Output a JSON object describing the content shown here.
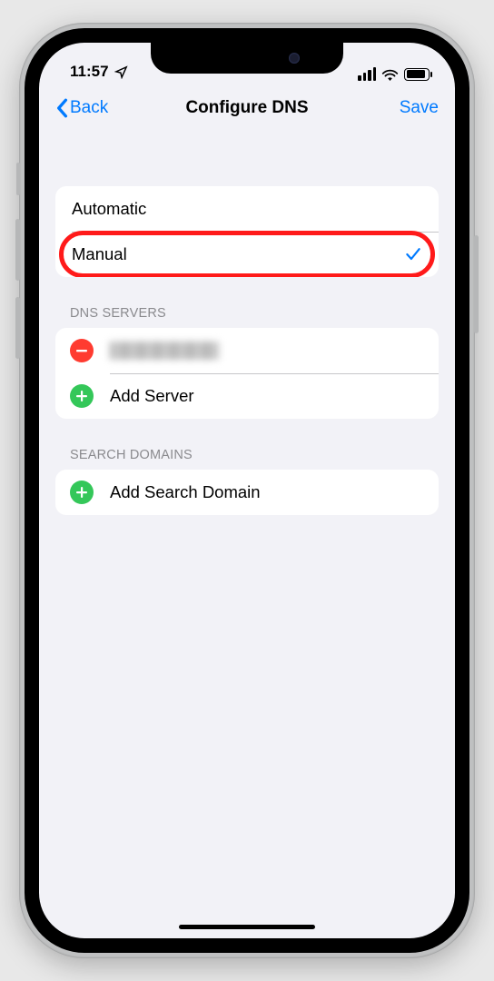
{
  "status": {
    "time": "11:57"
  },
  "nav": {
    "back_label": "Back",
    "title": "Configure DNS",
    "save_label": "Save"
  },
  "mode": {
    "automatic": "Automatic",
    "manual": "Manual",
    "selected": "manual"
  },
  "servers": {
    "header": "DNS SERVERS",
    "add_label": "Add Server"
  },
  "domains": {
    "header": "SEARCH DOMAINS",
    "add_label": "Add Search Domain"
  },
  "colors": {
    "accent": "#007aff",
    "delete": "#ff3b30",
    "add": "#34c759",
    "highlight": "#ff1a1a"
  }
}
